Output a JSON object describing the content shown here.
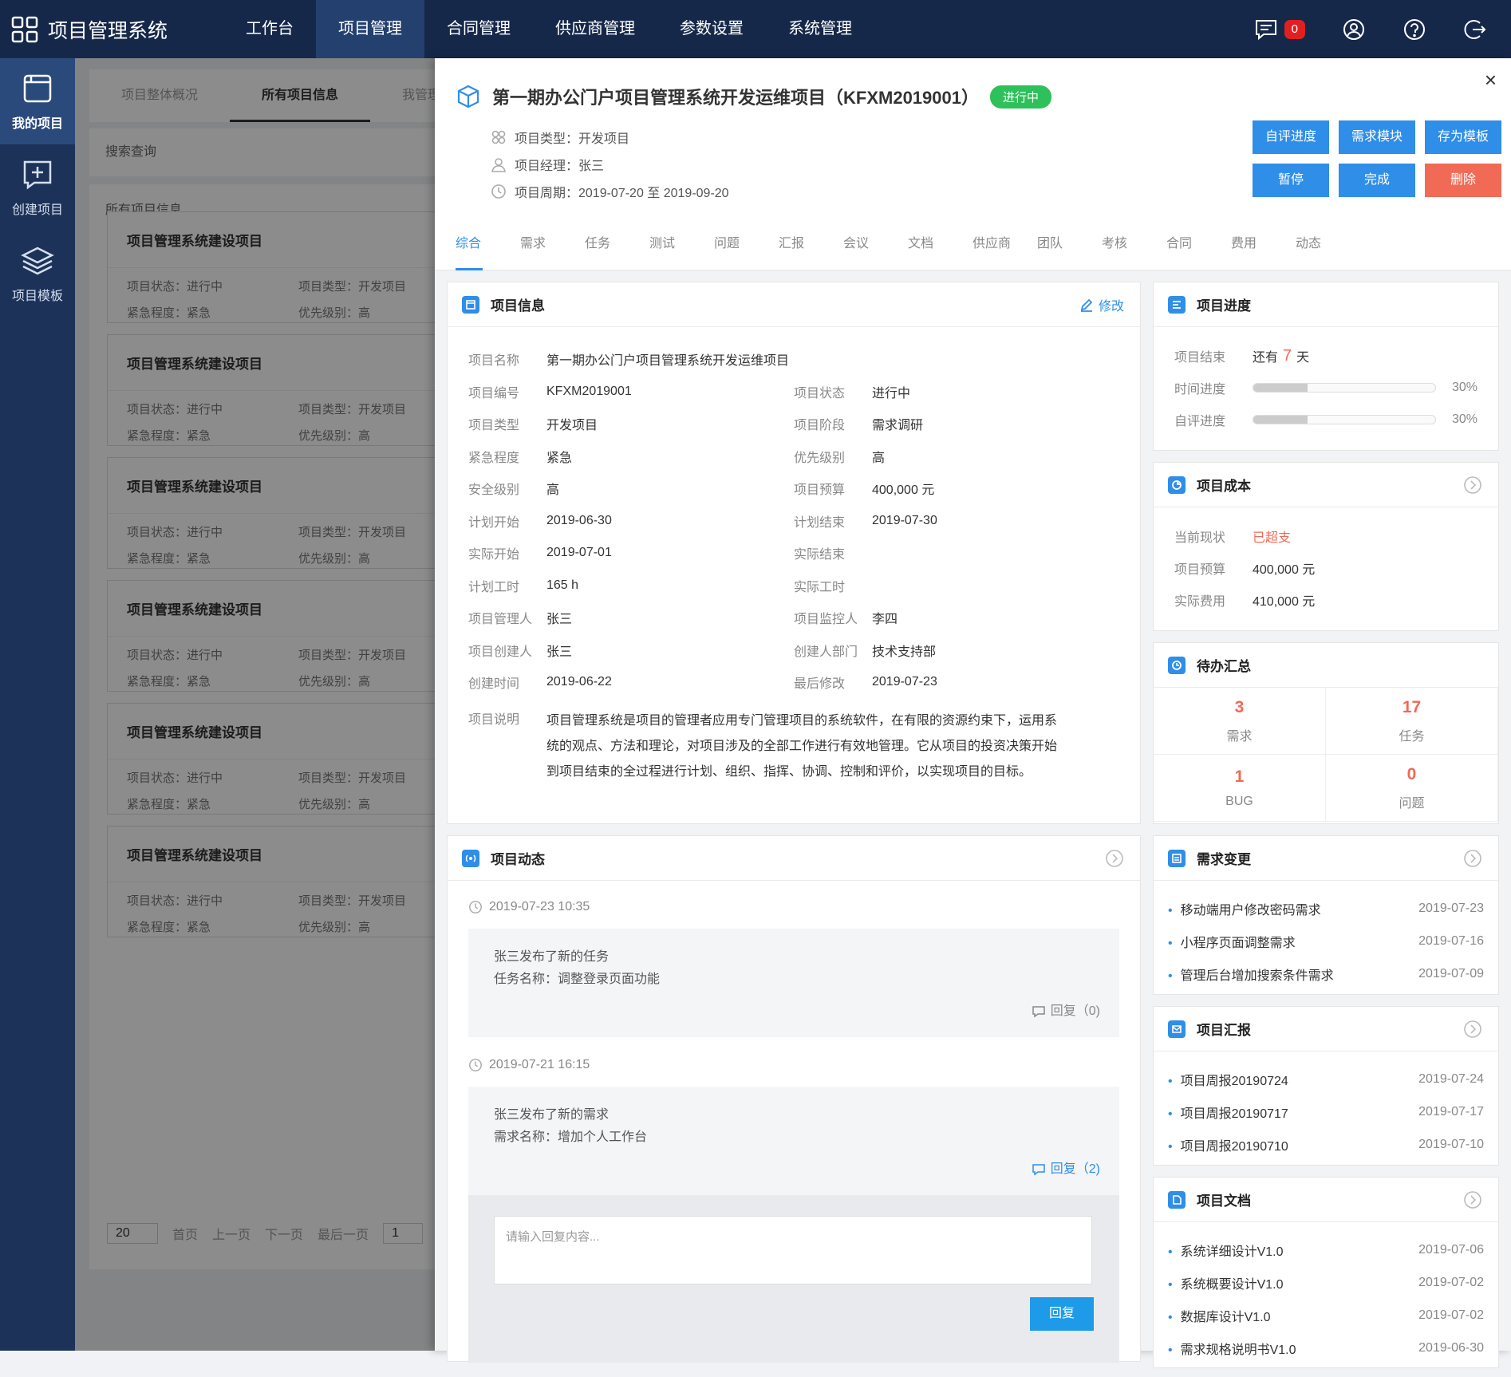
{
  "app": {
    "title": "项目管理系统"
  },
  "topnav": [
    "工作台",
    "项目管理",
    "合同管理",
    "供应商管理",
    "参数设置",
    "系统管理"
  ],
  "topnav_active": 1,
  "message_count": "0",
  "sidebar": [
    {
      "label": "我的项目"
    },
    {
      "label": "创建项目"
    },
    {
      "label": "项目模板"
    }
  ],
  "bg": {
    "tabs": [
      "项目整体概况",
      "所有项目信息",
      "我管理"
    ],
    "search_label": "搜索查询",
    "list_label": "所有项目信息",
    "card_title": "项目管理系统建设项目",
    "card_status": "项目状态：进行中",
    "card_type": "项目类型：开发项目",
    "card_urgency": "紧急程度：紧急",
    "card_priority": "优先级别：高",
    "pager": {
      "size": "20",
      "first": "首页",
      "prev": "上一页",
      "next": "下一页",
      "last": "最后一页",
      "page": "1"
    }
  },
  "drawer": {
    "close": "×",
    "title": "第一期办公门户项目管理系统开发运维项目（KFXM2019001）",
    "status": "进行中",
    "meta": {
      "type": "项目类型：开发项目",
      "manager": "项目经理：张三",
      "period": "项目周期：2019-07-20 至 2019-09-20"
    },
    "buttons": [
      "自评进度",
      "需求模块",
      "存为模板",
      "暂停",
      "完成",
      "删除"
    ],
    "tabs": [
      "综合",
      "需求",
      "任务",
      "测试",
      "问题",
      "汇报",
      "会议",
      "文档",
      "供应商",
      "团队",
      "考核",
      "合同",
      "费用",
      "动态"
    ]
  },
  "info": {
    "title": "项目信息",
    "edit": "修改",
    "name_label": "项目名称",
    "name": "第一期办公门户项目管理系统开发运维项目",
    "rows": [
      [
        "项目编号",
        "KFXM2019001",
        "项目状态",
        "进行中"
      ],
      [
        "项目类型",
        "开发项目",
        "项目阶段",
        "需求调研"
      ],
      [
        "紧急程度",
        "紧急",
        "优先级别",
        "高"
      ],
      [
        "安全级别",
        "高",
        "项目预算",
        "400,000 元"
      ],
      [
        "计划开始",
        "2019-06-30",
        "计划结束",
        "2019-07-30"
      ],
      [
        "实际开始",
        "2019-07-01",
        "实际结束",
        ""
      ],
      [
        "计划工时",
        "165 h",
        "实际工时",
        ""
      ],
      [
        "项目管理人",
        "张三",
        "项目监控人",
        "李四"
      ],
      [
        "项目创建人",
        "张三",
        "创建人部门",
        "技术支持部"
      ],
      [
        "创建时间",
        "2019-06-22",
        "最后修改",
        "2019-07-23"
      ]
    ],
    "desc_label": "项目说明",
    "desc": "项目管理系统是项目的管理者应用专门管理项目的系统软件，在有限的资源约束下，运用系统的观点、方法和理论，对项目涉及的全部工作进行有效地管理。它从项目的投资决策开始到项目结束的全过程进行计划、组织、指挥、协调、控制和评价，以实现项目的目标。"
  },
  "progress": {
    "title": "项目进度",
    "end_label": "项目结束",
    "end_prefix": "还有",
    "end_days": "7",
    "end_suffix": "天",
    "time_label": "时间进度",
    "time_pct": "30%",
    "time_value": 0.3,
    "self_label": "自评进度",
    "self_pct": "30%",
    "self_value": 0.3
  },
  "cost": {
    "title": "项目成本",
    "status_label": "当前现状",
    "status": "已超支",
    "budget_label": "项目预算",
    "budget": "400,000 元",
    "actual_label": "实际费用",
    "actual": "410,000 元"
  },
  "todo": {
    "title": "待办汇总",
    "items": [
      {
        "n": "3",
        "l": "需求"
      },
      {
        "n": "17",
        "l": "任务"
      },
      {
        "n": "1",
        "l": "BUG"
      },
      {
        "n": "0",
        "l": "问题"
      }
    ]
  },
  "feed": {
    "title": "项目动态",
    "items": [
      {
        "time": "2019-07-23 10:35",
        "line1": "张三发布了新的任务",
        "line2": "任务名称：调整登录页面功能",
        "reply": "回复（0)"
      },
      {
        "time": "2019-07-21 16:15",
        "line1": "张三发布了新的需求",
        "line2": "需求名称：增加个人工作台",
        "reply": "回复（2)"
      }
    ],
    "reply_placeholder": "请输入回复内容...",
    "reply_button": "回复"
  },
  "req_change": {
    "title": "需求变更",
    "items": [
      [
        "移动端用户修改密码需求",
        "2019-07-23"
      ],
      [
        "小程序页面调整需求",
        "2019-07-16"
      ],
      [
        "管理后台增加搜索条件需求",
        "2019-07-09"
      ]
    ]
  },
  "report": {
    "title": "项目汇报",
    "items": [
      [
        "项目周报20190724",
        "2019-07-24"
      ],
      [
        "项目周报20190717",
        "2019-07-17"
      ],
      [
        "项目周报20190710",
        "2019-07-10"
      ]
    ]
  },
  "docs": {
    "title": "项目文档",
    "items": [
      [
        "系统详细设计V1.0",
        "2019-07-06"
      ],
      [
        "系统概要设计V1.0",
        "2019-07-02"
      ],
      [
        "数据库设计V1.0",
        "2019-07-02"
      ],
      [
        "需求规格说明书V1.0",
        "2019-06-30"
      ]
    ]
  },
  "colors": {
    "primary": "#2f8ee8",
    "danger": "#f06a56",
    "success": "#2ec05a",
    "nav": "#16284a"
  }
}
